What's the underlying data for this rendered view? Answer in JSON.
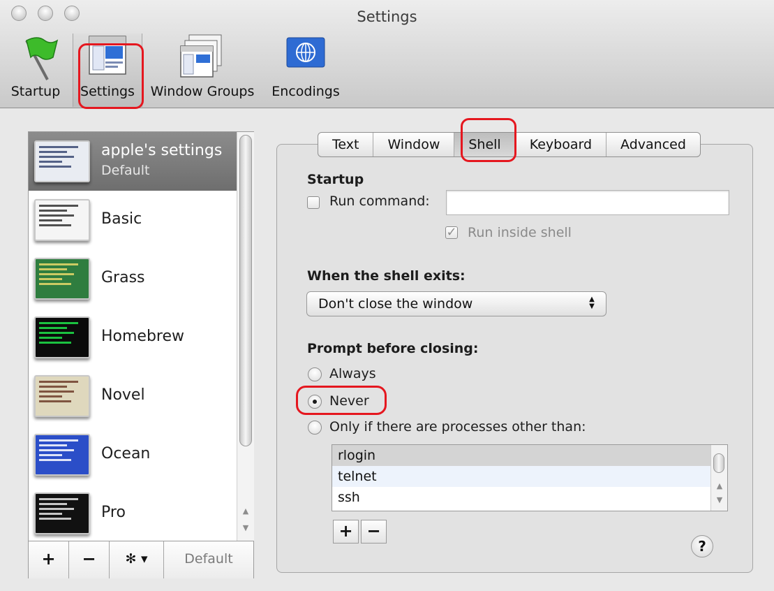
{
  "window": {
    "title": "Settings"
  },
  "toolbar": {
    "items": [
      {
        "label": "Startup",
        "icon": "green-flag-icon"
      },
      {
        "label": "Settings",
        "icon": "settings-window-icon"
      },
      {
        "label": "Window Groups",
        "icon": "window-groups-icon"
      },
      {
        "label": "Encodings",
        "icon": "globe-flag-icon"
      }
    ],
    "selected": "Settings"
  },
  "profiles": {
    "items": [
      {
        "name": "apple's settings",
        "subtitle": "Default",
        "bg": "#e9ecf2",
        "line": "#3b4a74"
      },
      {
        "name": "Basic",
        "bg": "#f5f5f5",
        "line": "#333333"
      },
      {
        "name": "Grass",
        "bg": "#2f7d3f",
        "line": "#e8d86a"
      },
      {
        "name": "Homebrew",
        "bg": "#0b0b0b",
        "line": "#1fe24a"
      },
      {
        "name": "Novel",
        "bg": "#dfd8bd",
        "line": "#6e3d2a"
      },
      {
        "name": "Ocean",
        "bg": "#2b4ec8",
        "line": "#ffffff"
      },
      {
        "name": "Pro",
        "bg": "#111111",
        "line": "#e6e6e6"
      }
    ],
    "selected_index": 0,
    "footer": {
      "add": "+",
      "remove": "−",
      "action": "✻ ▾",
      "default": "Default"
    }
  },
  "tabs": {
    "items": [
      "Text",
      "Window",
      "Shell",
      "Keyboard",
      "Advanced"
    ],
    "active": "Shell"
  },
  "shell": {
    "startup_header": "Startup",
    "run_command_label": "Run command:",
    "run_command_value": "",
    "run_command_checked": false,
    "run_inside_shell_label": "Run inside shell",
    "run_inside_shell_checked": true,
    "exit_header": "When the shell exits:",
    "exit_option": "Don't close the window",
    "prompt_header": "Prompt before closing:",
    "prompt_options": [
      "Always",
      "Never",
      "Only if there are processes other than:"
    ],
    "prompt_selected": "Never",
    "processes": [
      "rlogin",
      "telnet",
      "ssh"
    ],
    "add": "+",
    "remove": "−",
    "help": "?"
  },
  "colors": {
    "highlight": "#e5171f",
    "selected_row": "#7d7d7d"
  }
}
